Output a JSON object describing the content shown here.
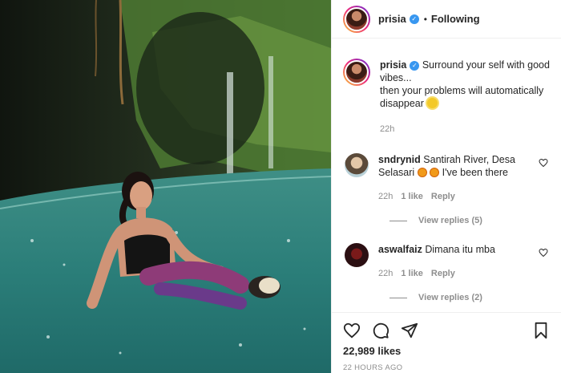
{
  "colors": {
    "accent_blue": "#3897f0",
    "muted_text": "#8e8e8e",
    "text": "#262626",
    "divider": "#efefef"
  },
  "photo": {
    "description_icon": "post-photo"
  },
  "header": {
    "username": "prisia",
    "verified_icon": "verified-badge-icon",
    "separator": "•",
    "follow_status": "Following"
  },
  "caption": {
    "username": "prisia",
    "text_line1": "Surround your self with good vibes...",
    "text_line2": "then your problems will automatically disappear",
    "emoji_icon": "sun-emoji-icon",
    "time": "22h"
  },
  "comments": [
    {
      "username": "sndrynid",
      "text_before": "Santirah River, Desa Selasari",
      "text_after": "I've been there",
      "time": "22h",
      "likes": "1 like",
      "reply": "Reply",
      "view_replies": "View replies (5)"
    },
    {
      "username": "aswalfaiz",
      "text": "Dimana itu mba",
      "time": "22h",
      "likes": "1 like",
      "reply": "Reply",
      "view_replies": "View replies (2)"
    }
  ],
  "actions": {
    "like_icon": "heart-icon",
    "comment_icon": "comment-icon",
    "share_icon": "share-icon",
    "save_icon": "bookmark-icon"
  },
  "likes_count": "22,989 likes",
  "posted_ago": "22 HOURS AGO"
}
